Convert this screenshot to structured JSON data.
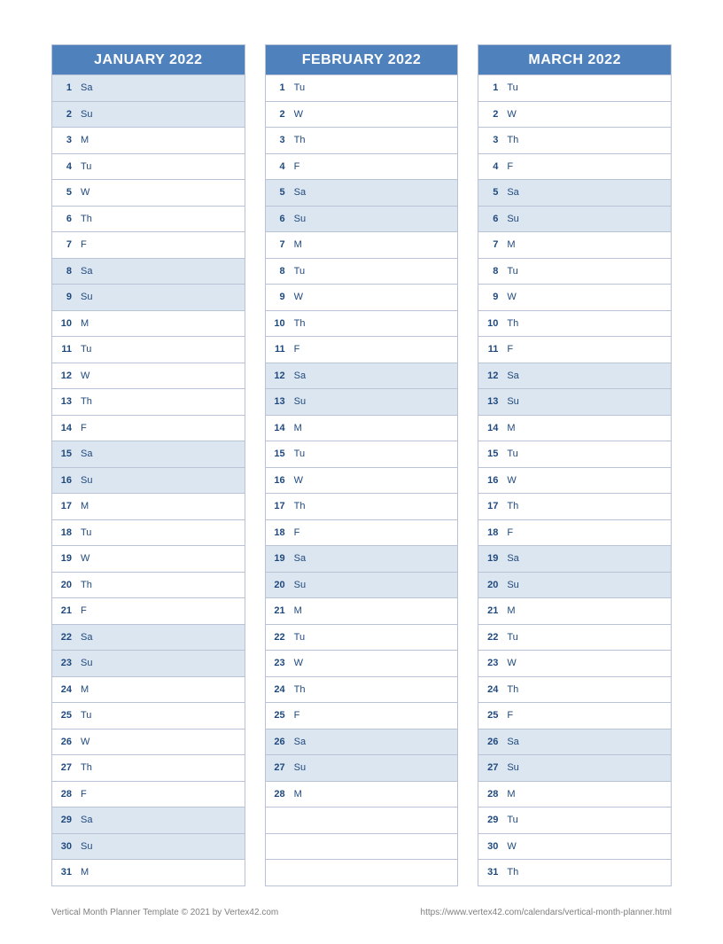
{
  "months": [
    {
      "title": "JANUARY 2022",
      "days": [
        {
          "n": "1",
          "d": "Sa",
          "w": true
        },
        {
          "n": "2",
          "d": "Su",
          "w": true
        },
        {
          "n": "3",
          "d": "M"
        },
        {
          "n": "4",
          "d": "Tu"
        },
        {
          "n": "5",
          "d": "W"
        },
        {
          "n": "6",
          "d": "Th"
        },
        {
          "n": "7",
          "d": "F"
        },
        {
          "n": "8",
          "d": "Sa",
          "w": true
        },
        {
          "n": "9",
          "d": "Su",
          "w": true
        },
        {
          "n": "10",
          "d": "M"
        },
        {
          "n": "11",
          "d": "Tu"
        },
        {
          "n": "12",
          "d": "W"
        },
        {
          "n": "13",
          "d": "Th"
        },
        {
          "n": "14",
          "d": "F"
        },
        {
          "n": "15",
          "d": "Sa",
          "w": true
        },
        {
          "n": "16",
          "d": "Su",
          "w": true
        },
        {
          "n": "17",
          "d": "M"
        },
        {
          "n": "18",
          "d": "Tu"
        },
        {
          "n": "19",
          "d": "W"
        },
        {
          "n": "20",
          "d": "Th"
        },
        {
          "n": "21",
          "d": "F"
        },
        {
          "n": "22",
          "d": "Sa",
          "w": true
        },
        {
          "n": "23",
          "d": "Su",
          "w": true
        },
        {
          "n": "24",
          "d": "M"
        },
        {
          "n": "25",
          "d": "Tu"
        },
        {
          "n": "26",
          "d": "W"
        },
        {
          "n": "27",
          "d": "Th"
        },
        {
          "n": "28",
          "d": "F"
        },
        {
          "n": "29",
          "d": "Sa",
          "w": true
        },
        {
          "n": "30",
          "d": "Su",
          "w": true
        },
        {
          "n": "31",
          "d": "M"
        }
      ]
    },
    {
      "title": "FEBRUARY 2022",
      "days": [
        {
          "n": "1",
          "d": "Tu"
        },
        {
          "n": "2",
          "d": "W"
        },
        {
          "n": "3",
          "d": "Th"
        },
        {
          "n": "4",
          "d": "F"
        },
        {
          "n": "5",
          "d": "Sa",
          "w": true
        },
        {
          "n": "6",
          "d": "Su",
          "w": true
        },
        {
          "n": "7",
          "d": "M"
        },
        {
          "n": "8",
          "d": "Tu"
        },
        {
          "n": "9",
          "d": "W"
        },
        {
          "n": "10",
          "d": "Th"
        },
        {
          "n": "11",
          "d": "F"
        },
        {
          "n": "12",
          "d": "Sa",
          "w": true
        },
        {
          "n": "13",
          "d": "Su",
          "w": true
        },
        {
          "n": "14",
          "d": "M"
        },
        {
          "n": "15",
          "d": "Tu"
        },
        {
          "n": "16",
          "d": "W"
        },
        {
          "n": "17",
          "d": "Th"
        },
        {
          "n": "18",
          "d": "F"
        },
        {
          "n": "19",
          "d": "Sa",
          "w": true
        },
        {
          "n": "20",
          "d": "Su",
          "w": true
        },
        {
          "n": "21",
          "d": "M"
        },
        {
          "n": "22",
          "d": "Tu"
        },
        {
          "n": "23",
          "d": "W"
        },
        {
          "n": "24",
          "d": "Th"
        },
        {
          "n": "25",
          "d": "F"
        },
        {
          "n": "26",
          "d": "Sa",
          "w": true
        },
        {
          "n": "27",
          "d": "Su",
          "w": true
        },
        {
          "n": "28",
          "d": "M"
        },
        {
          "empty": true
        },
        {
          "empty": true
        },
        {
          "empty": true
        }
      ]
    },
    {
      "title": "MARCH 2022",
      "days": [
        {
          "n": "1",
          "d": "Tu"
        },
        {
          "n": "2",
          "d": "W"
        },
        {
          "n": "3",
          "d": "Th"
        },
        {
          "n": "4",
          "d": "F"
        },
        {
          "n": "5",
          "d": "Sa",
          "w": true
        },
        {
          "n": "6",
          "d": "Su",
          "w": true
        },
        {
          "n": "7",
          "d": "M"
        },
        {
          "n": "8",
          "d": "Tu"
        },
        {
          "n": "9",
          "d": "W"
        },
        {
          "n": "10",
          "d": "Th"
        },
        {
          "n": "11",
          "d": "F"
        },
        {
          "n": "12",
          "d": "Sa",
          "w": true
        },
        {
          "n": "13",
          "d": "Su",
          "w": true
        },
        {
          "n": "14",
          "d": "M"
        },
        {
          "n": "15",
          "d": "Tu"
        },
        {
          "n": "16",
          "d": "W"
        },
        {
          "n": "17",
          "d": "Th"
        },
        {
          "n": "18",
          "d": "F"
        },
        {
          "n": "19",
          "d": "Sa",
          "w": true
        },
        {
          "n": "20",
          "d": "Su",
          "w": true
        },
        {
          "n": "21",
          "d": "M"
        },
        {
          "n": "22",
          "d": "Tu"
        },
        {
          "n": "23",
          "d": "W"
        },
        {
          "n": "24",
          "d": "Th"
        },
        {
          "n": "25",
          "d": "F"
        },
        {
          "n": "26",
          "d": "Sa",
          "w": true
        },
        {
          "n": "27",
          "d": "Su",
          "w": true
        },
        {
          "n": "28",
          "d": "M"
        },
        {
          "n": "29",
          "d": "Tu"
        },
        {
          "n": "30",
          "d": "W"
        },
        {
          "n": "31",
          "d": "Th"
        }
      ]
    }
  ],
  "footer": {
    "left": "Vertical Month Planner Template © 2021 by Vertex42.com",
    "right": "https://www.vertex42.com/calendars/vertical-month-planner.html"
  }
}
